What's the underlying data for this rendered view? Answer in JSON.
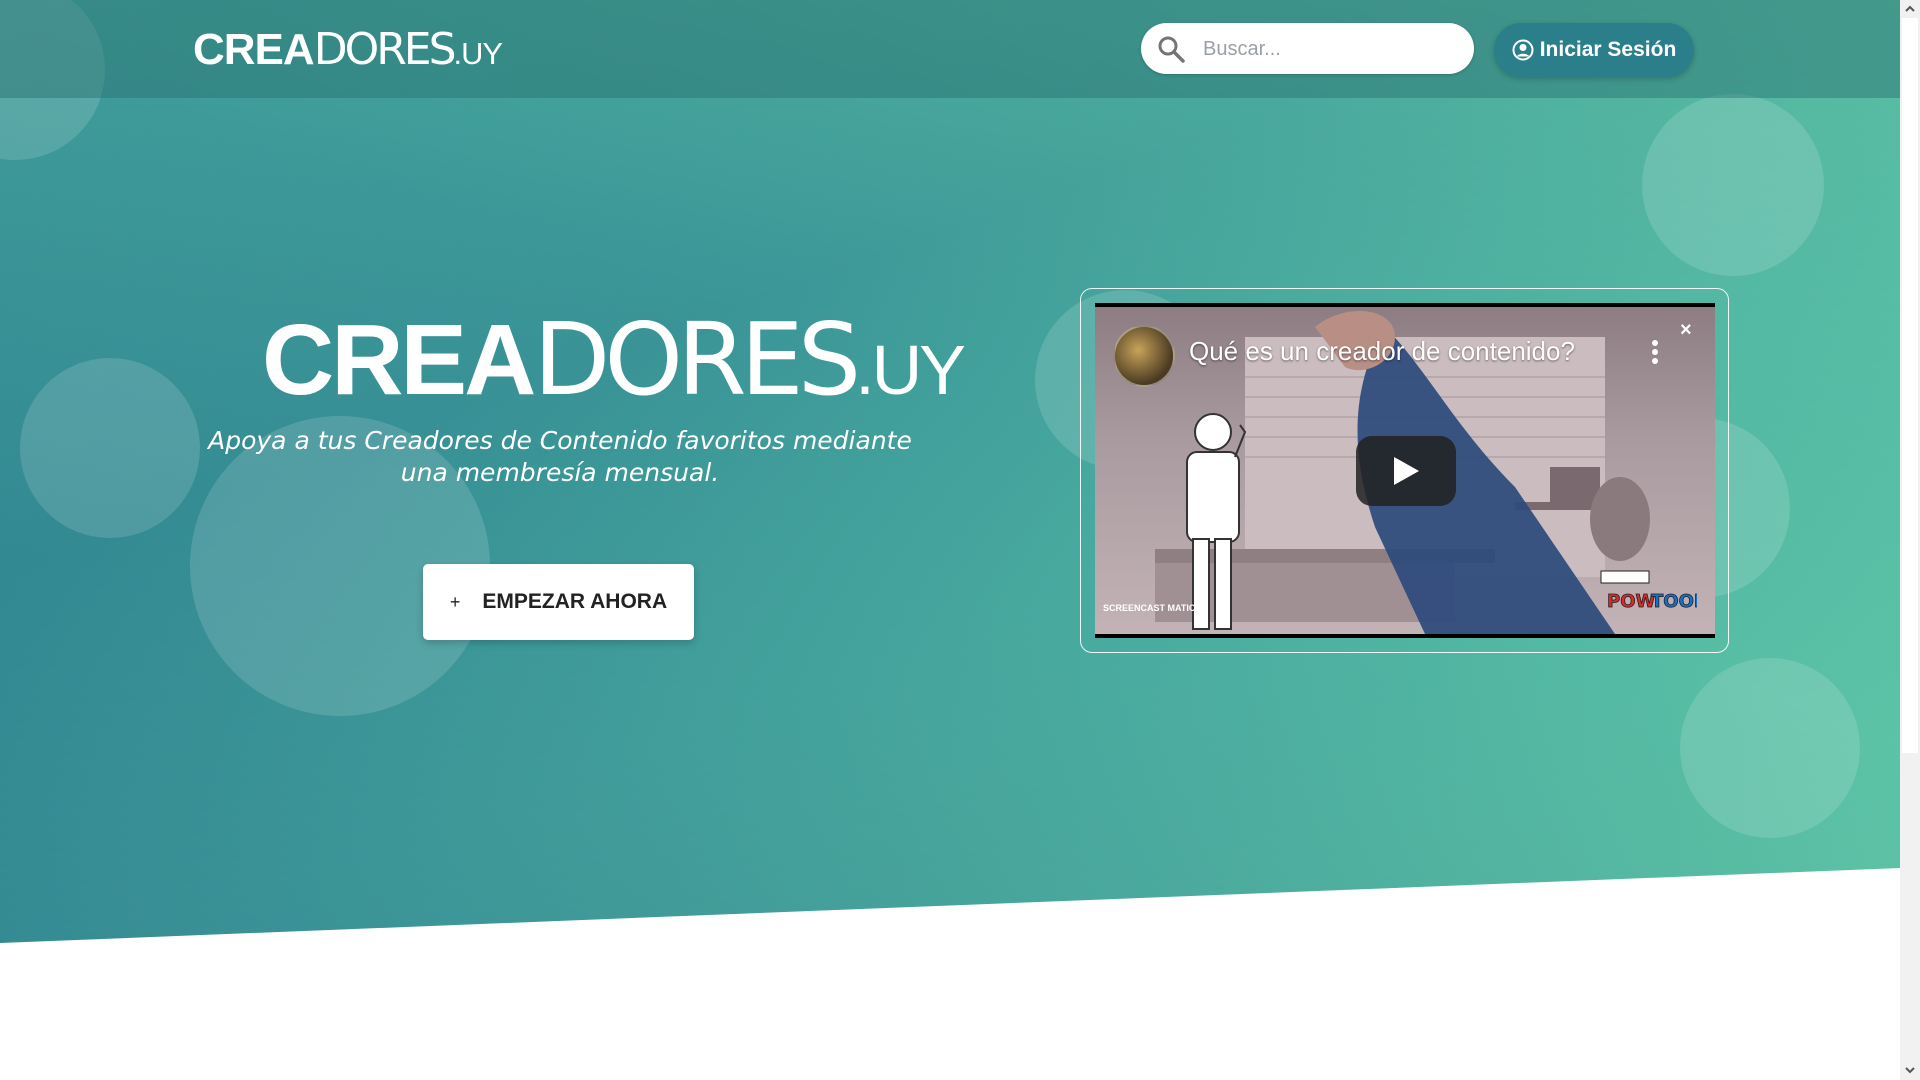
{
  "header": {
    "logo": {
      "bold": "CREA",
      "light": "DORES",
      "suffix": ".UY"
    },
    "search": {
      "placeholder": "Buscar..."
    },
    "login_label": "Iniciar Sesión"
  },
  "hero": {
    "logo": {
      "bold": "CREA",
      "light": "DORES",
      "suffix": ".UY"
    },
    "tagline": "Apoya a tus Creadores de Contenido favoritos mediante una membresía mensual.",
    "cta": {
      "icon": "+",
      "label": "EMPEZAR AHORA"
    }
  },
  "video": {
    "title": "Qué es un creador de contenido?",
    "close_glyph": "×",
    "watermark_left": "SCREENCAST  MATIC",
    "watermark_right": "POWTOON"
  },
  "colors": {
    "header_button": "#2a7f8a",
    "hero_gradient_start": "#3a9597",
    "hero_gradient_end": "#64cca8"
  }
}
